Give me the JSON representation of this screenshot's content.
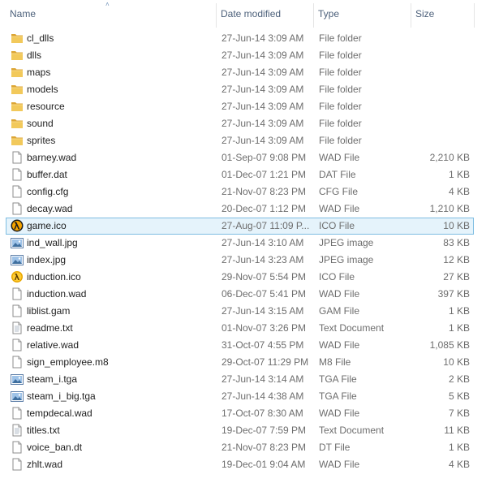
{
  "columns": {
    "name": "Name",
    "date": "Date modified",
    "type": "Type",
    "size": "Size"
  },
  "sort_indicator": "˄",
  "files": [
    {
      "name": "cl_dlls",
      "date": "27-Jun-14 3:09 AM",
      "type": "File folder",
      "size": "",
      "icon": "folder-icon"
    },
    {
      "name": "dlls",
      "date": "27-Jun-14 3:09 AM",
      "type": "File folder",
      "size": "",
      "icon": "folder-icon"
    },
    {
      "name": "maps",
      "date": "27-Jun-14 3:09 AM",
      "type": "File folder",
      "size": "",
      "icon": "folder-icon"
    },
    {
      "name": "models",
      "date": "27-Jun-14 3:09 AM",
      "type": "File folder",
      "size": "",
      "icon": "folder-icon"
    },
    {
      "name": "resource",
      "date": "27-Jun-14 3:09 AM",
      "type": "File folder",
      "size": "",
      "icon": "folder-icon"
    },
    {
      "name": "sound",
      "date": "27-Jun-14 3:09 AM",
      "type": "File folder",
      "size": "",
      "icon": "folder-icon"
    },
    {
      "name": "sprites",
      "date": "27-Jun-14 3:09 AM",
      "type": "File folder",
      "size": "",
      "icon": "folder-icon"
    },
    {
      "name": "barney.wad",
      "date": "01-Sep-07 9:08 PM",
      "type": "WAD File",
      "size": "2,210 KB",
      "icon": "document-icon"
    },
    {
      "name": "buffer.dat",
      "date": "01-Dec-07 1:21 PM",
      "type": "DAT File",
      "size": "1 KB",
      "icon": "document-icon"
    },
    {
      "name": "config.cfg",
      "date": "21-Nov-07 8:23 PM",
      "type": "CFG File",
      "size": "4 KB",
      "icon": "document-icon"
    },
    {
      "name": "decay.wad",
      "date": "20-Dec-07 1:12 PM",
      "type": "WAD File",
      "size": "1,210 KB",
      "icon": "document-icon"
    },
    {
      "name": "game.ico",
      "date": "27-Aug-07 11:09 P...",
      "type": "ICO File",
      "size": "10 KB",
      "icon": "lambda-icon",
      "selected": true
    },
    {
      "name": "ind_wall.jpg",
      "date": "27-Jun-14 3:10 AM",
      "type": "JPEG image",
      "size": "83 KB",
      "icon": "image-icon"
    },
    {
      "name": "index.jpg",
      "date": "27-Jun-14 3:23 AM",
      "type": "JPEG image",
      "size": "12 KB",
      "icon": "image-icon"
    },
    {
      "name": "induction.ico",
      "date": "29-Nov-07 5:54 PM",
      "type": "ICO File",
      "size": "27 KB",
      "icon": "lambda-small-icon"
    },
    {
      "name": "induction.wad",
      "date": "06-Dec-07 5:41 PM",
      "type": "WAD File",
      "size": "397 KB",
      "icon": "document-icon"
    },
    {
      "name": "liblist.gam",
      "date": "27-Jun-14 3:15 AM",
      "type": "GAM File",
      "size": "1 KB",
      "icon": "document-icon"
    },
    {
      "name": "readme.txt",
      "date": "01-Nov-07 3:26 PM",
      "type": "Text Document",
      "size": "1 KB",
      "icon": "text-document-icon"
    },
    {
      "name": "relative.wad",
      "date": "31-Oct-07 4:55 PM",
      "type": "WAD File",
      "size": "1,085 KB",
      "icon": "document-icon"
    },
    {
      "name": "sign_employee.m8",
      "date": "29-Oct-07 11:29 PM",
      "type": "M8 File",
      "size": "10 KB",
      "icon": "document-icon"
    },
    {
      "name": "steam_i.tga",
      "date": "27-Jun-14 3:14 AM",
      "type": "TGA File",
      "size": "2 KB",
      "icon": "image-icon"
    },
    {
      "name": "steam_i_big.tga",
      "date": "27-Jun-14 4:38 AM",
      "type": "TGA File",
      "size": "5 KB",
      "icon": "image-icon"
    },
    {
      "name": "tempdecal.wad",
      "date": "17-Oct-07 8:30 AM",
      "type": "WAD File",
      "size": "7 KB",
      "icon": "document-icon"
    },
    {
      "name": "titles.txt",
      "date": "19-Dec-07 7:59 PM",
      "type": "Text Document",
      "size": "11 KB",
      "icon": "text-document-icon"
    },
    {
      "name": "voice_ban.dt",
      "date": "21-Nov-07 8:23 PM",
      "type": "DT File",
      "size": "1 KB",
      "icon": "document-icon"
    },
    {
      "name": "zhlt.wad",
      "date": "19-Dec-01 9:04 AM",
      "type": "WAD File",
      "size": "4 KB",
      "icon": "document-icon"
    }
  ],
  "colors": {
    "selection_bg": "#e5f3fb",
    "selection_border": "#7ebde2",
    "header_text": "#4c607a",
    "folder": "#e8b94a"
  }
}
